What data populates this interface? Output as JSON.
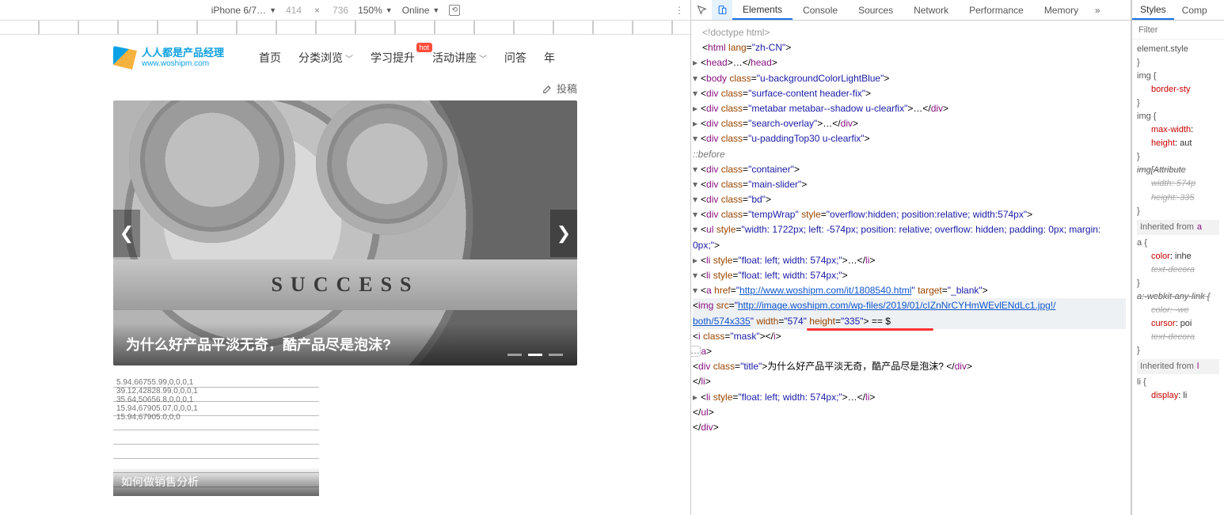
{
  "devtoolbar": {
    "device": "iPhone 6/7…",
    "width": "414",
    "height": "736",
    "zoom": "150%",
    "network": "Online"
  },
  "site": {
    "logo_title": "人人都是产品经理",
    "logo_sub": "www.woshipm.com",
    "nav": {
      "home": "首页",
      "browse": "分类浏览",
      "learn": "学习提升",
      "learn_badge": "hot",
      "events": "活动讲座",
      "qa": "问答",
      "more": "年"
    },
    "post_link": "投稿",
    "slider_title": "为什么好产品平淡无奇，酷产品尽是泡沫?",
    "success_text": "SUCCESS",
    "article2_title": "如何做销售分析",
    "article2_numbers": "5.94,66755.99,0,0,0,1\n39.12,42828.99,0,0,0,1\n35.64,50656.8,0,0,0,1\n15.94,67905.07,0,0,0,1\n15.94,67905.0,0,0"
  },
  "dt_tabs": {
    "elements": "Elements",
    "console": "Console",
    "sources": "Sources",
    "network": "Network",
    "performance": "Performance",
    "memory": "Memory"
  },
  "dom": {
    "doctype": "<!doctype html>",
    "html_open": "<html lang=\"zh-CN\">",
    "head": "<head>…</head>",
    "body_open": "<body class=\"u-backgroundColorLightBlue\">",
    "surface_open": "<div class=\"surface-content header-fix\">",
    "metabar": "<div class=\"metabar metabar--shadow u-clearfix\">…</div>",
    "search": "<div class=\"search-overlay\">…</div>",
    "padtop_open": "<div class=\"u-paddingTop30 u-clearfix\">",
    "before": "::before",
    "container_open": "<div class=\"container\">",
    "mainslider_open": "<div class=\"main-slider\">",
    "bd_open": "<div class=\"bd\">",
    "tempwrap_open": "<div class=\"tempWrap\" style=\"overflow:hidden; position:relative; width:574px\">",
    "ul_open": "<ul style=\"width: 1722px; left: -574px; position: relative; overflow: hidden; padding: 0px; margin: 0px;\">",
    "li1": "<li style=\"float: left; width: 574px;\">…</li>",
    "li2_open": "<li style=\"float: left; width: 574px;\">",
    "a_open": "<a href=\"http://www.woshipm.com/it/1808540.html\" target=\"_blank\">",
    "img_line1": "<img src=\"http://image.woshipm.com/wp-files/2019/01/cIZnNrCYHmWEvlENdLc1.jpg!/both/574x335\" width=\"574\" height=\"335\"> == $",
    "imask": "<i class=\"mask\"></i>",
    "a_close": "</a>",
    "title_div": "<div class=\"title\">为什么好产品平淡无奇，酷产品尽是泡沫? </div>",
    "li2_close": "</li>",
    "li3": "<li style=\"float: left; width: 574px;\">…</li>",
    "ul_close": "</ul>",
    "tempwrap_close": "</div>"
  },
  "styles": {
    "tab_styles": "Styles",
    "tab_comp": "Comp",
    "filter_placeholder": "Filter",
    "r_element": "element.style",
    "r_img1_sel": "img",
    "r_img1_prop": "border-sty",
    "r_img2_sel": "img",
    "r_img2_maxw": "max-width",
    "r_img2_h": "height",
    "r_img2_h_val": "aut",
    "r_imgattr_sel": "img[Attribute",
    "r_imgattr_w": "width",
    "r_imgattr_w_val": "574p",
    "r_imgattr_h": "height",
    "r_imgattr_h_val": "335",
    "inh1": "Inherited from",
    "inh1_tag": "a",
    "r_a_sel": "a",
    "r_a_color": "color",
    "r_a_color_v": "inhe",
    "r_a_td": "text-decora",
    "r_awv_sel": "a:-webkit-any-link",
    "r_awv_color": "color",
    "r_awv_color_v": "-we",
    "r_awv_cursor": "cursor",
    "r_awv_cursor_v": "poi",
    "r_awv_td": "text-decora",
    "inh2": "Inherited from",
    "inh2_tag": "l",
    "r_li_sel": "li",
    "r_li_disp": "display",
    "r_li_disp_v": "li"
  }
}
